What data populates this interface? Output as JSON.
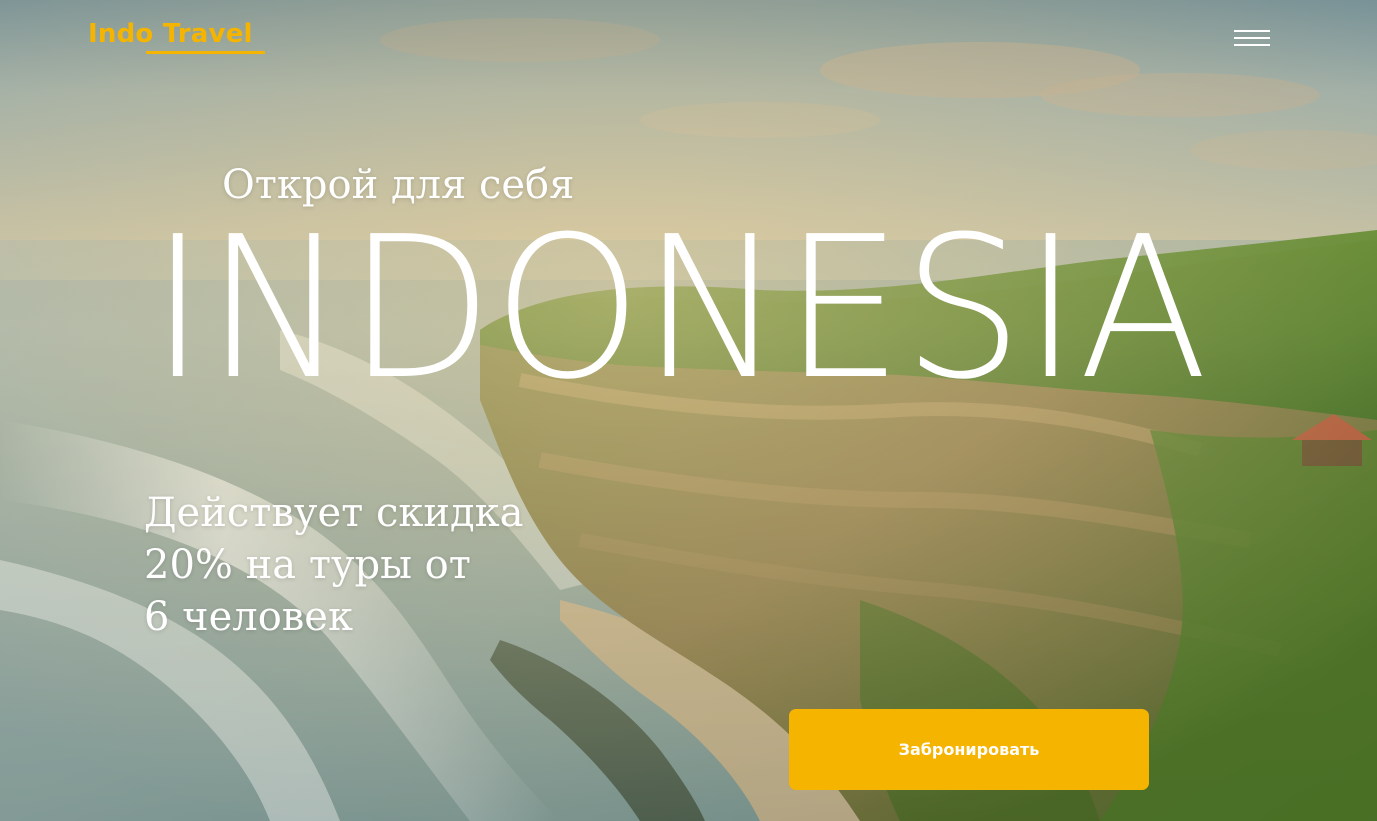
{
  "header": {
    "logo_text": "Indo Travel",
    "menu_icon": "hamburger-menu-icon"
  },
  "hero": {
    "subtitle": "Открой для себя",
    "title": "INDONESIA",
    "discount_lines": [
      "Действует скидка",
      "20% на туры от",
      "6 человек"
    ],
    "cta_label": "Забронировать"
  },
  "colors": {
    "accent": "#f5b400",
    "text_light": "#ffffff"
  }
}
